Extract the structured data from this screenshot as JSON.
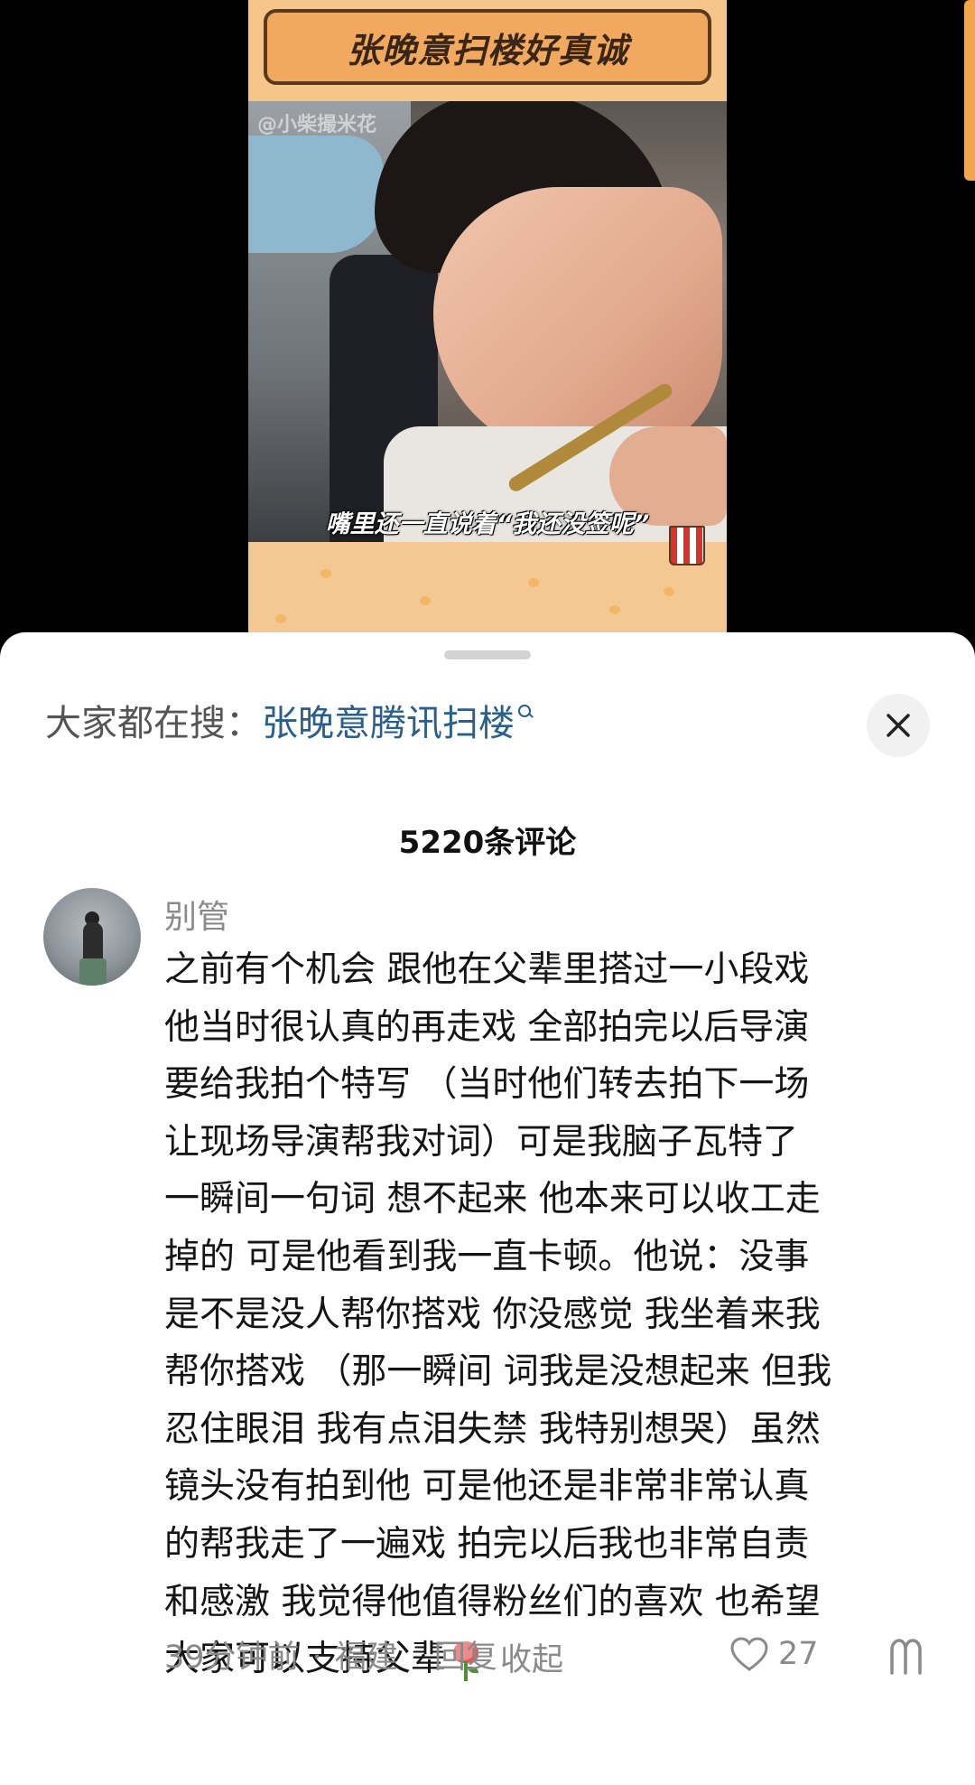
{
  "video": {
    "title_banner": "张晚意扫楼好真诚",
    "watermark": "@小柴撮米花",
    "subtitle": "嘴里还一直说着“我还没签呢”"
  },
  "sheet": {
    "search": {
      "prefix": "大家都在搜：",
      "query": "张晚意腾讯扫楼",
      "icon": "search-icon"
    },
    "close_icon": "close-icon",
    "comment_count": "5220条评论",
    "comment": {
      "username": "别管",
      "lines": [
        "之前有个机会 跟他在父辈里搭过一小段戏",
        "他当时很认真的再走戏 全部拍完以后导演",
        "要给我拍个特写 （当时他们转去拍下一场",
        "让现场导演帮我对词）可是我脑子瓦特了",
        "一瞬间一句词 想不起来 他本来可以收工走",
        "掉的 可是他看到我一直卡顿。他说：没事",
        "是不是没人帮你搭戏 你没感觉 我坐着来我",
        "帮你搭戏 （那一瞬间 词我是没想起来 但我",
        "忍住眼泪 我有点泪失禁 我特别想哭）虽然",
        "镜头没有拍到他 可是他还是非常非常认真",
        "的帮我走了一遍戏  拍完以后我也非常自责",
        "和感激 我觉得他值得粉丝们的喜欢 也希望",
        "大家可以支持父辈"
      ],
      "collapse_label": "收起",
      "time": "39分钟前",
      "separator": "·",
      "location": "福建",
      "reply_label": "回复",
      "like_count": "27"
    }
  }
}
